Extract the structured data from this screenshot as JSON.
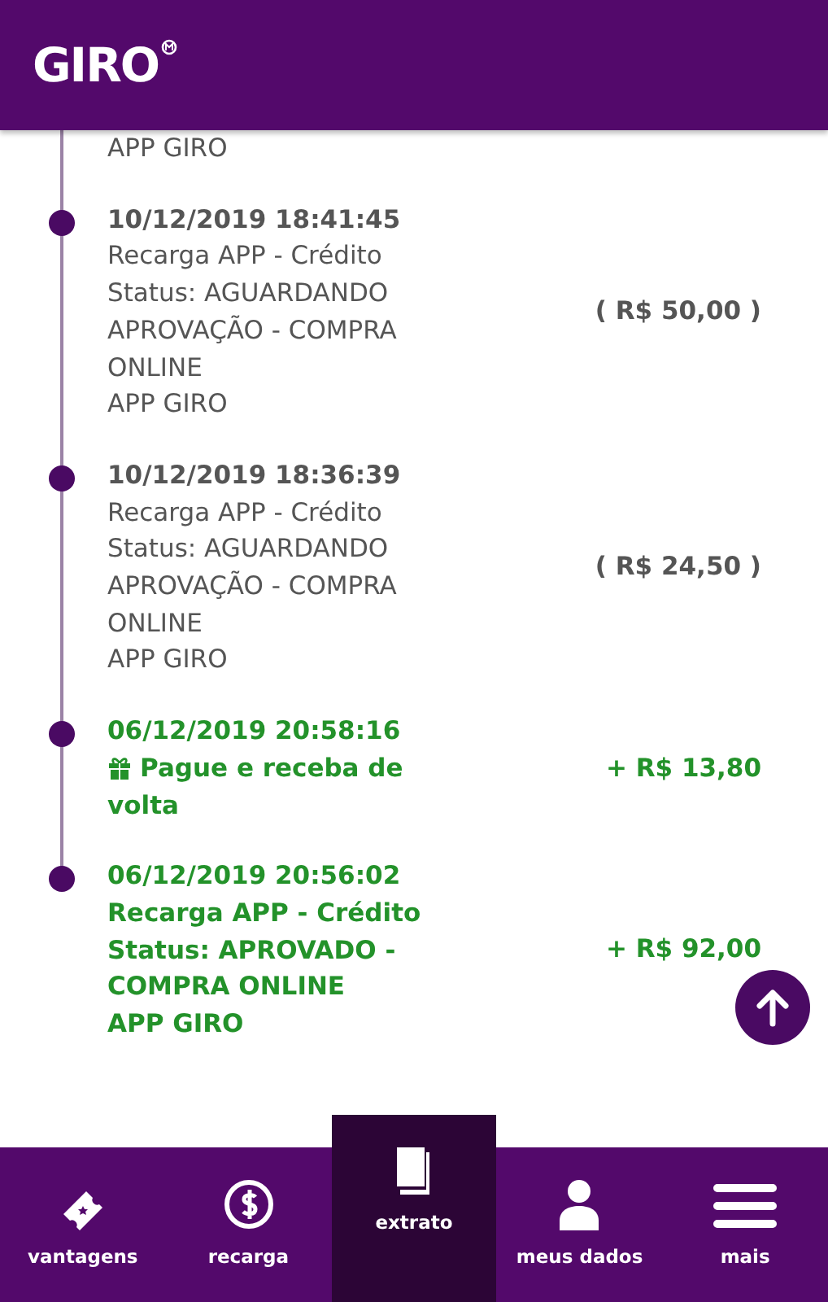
{
  "header": {
    "logo": "GIRO"
  },
  "entries": [
    {
      "kind": "pending",
      "lines": [
        "APP GIRO"
      ],
      "gift": false
    },
    {
      "kind": "pending",
      "date": "10/12/2019 18:41:45",
      "lines": [
        "Recarga APP - Crédito",
        "Status: AGUARDANDO",
        "APROVAÇÃO - COMPRA",
        "ONLINE",
        "APP GIRO"
      ],
      "amount": "( R$ 50,00 )",
      "gift": false
    },
    {
      "kind": "pending",
      "date": "10/12/2019 18:36:39",
      "lines": [
        "Recarga APP - Crédito",
        "Status: AGUARDANDO",
        "APROVAÇÃO - COMPRA",
        "ONLINE",
        "APP GIRO"
      ],
      "amount": "( R$ 24,50 )",
      "gift": false
    },
    {
      "kind": "credit",
      "date": "06/12/2019 20:58:16",
      "lines": [
        "Pague e receba de",
        "volta"
      ],
      "amount": "+ R$ 13,80",
      "gift": true
    },
    {
      "kind": "credit",
      "date": "06/12/2019 20:56:02",
      "lines": [
        "Recarga APP - Crédito",
        "Status: APROVADO -",
        "COMPRA ONLINE",
        "APP GIRO"
      ],
      "amount": "+ R$ 92,00",
      "gift": false
    }
  ],
  "nav": [
    {
      "label": "vantagens",
      "selected": false
    },
    {
      "label": "recarga",
      "selected": false
    },
    {
      "label": "extrato",
      "selected": true
    },
    {
      "label": "meus dados",
      "selected": false
    },
    {
      "label": "mais",
      "selected": false
    }
  ]
}
